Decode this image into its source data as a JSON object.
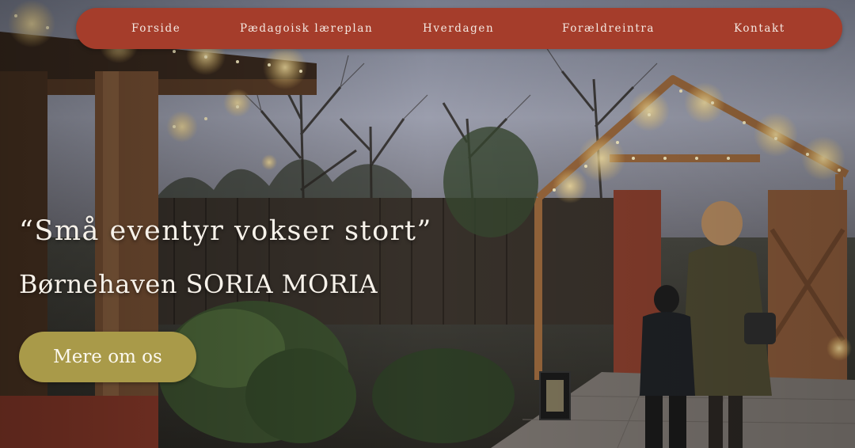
{
  "nav": {
    "items": [
      {
        "label": "Forside"
      },
      {
        "label": "Pædagoisk læreplan"
      },
      {
        "label": "Hverdagen"
      },
      {
        "label": "Forældreintra"
      },
      {
        "label": "Kontakt"
      }
    ]
  },
  "hero": {
    "quote": "“Små eventyr vokser stort”",
    "subtitle": "Børnehaven SORIA MORIA",
    "cta_label": "Mere om os"
  },
  "colors": {
    "nav_background": "#a53d2b",
    "cta_background": "#a99a49",
    "text_light": "#f7f2ea"
  },
  "icons": {
    "background": "garden-photo"
  }
}
